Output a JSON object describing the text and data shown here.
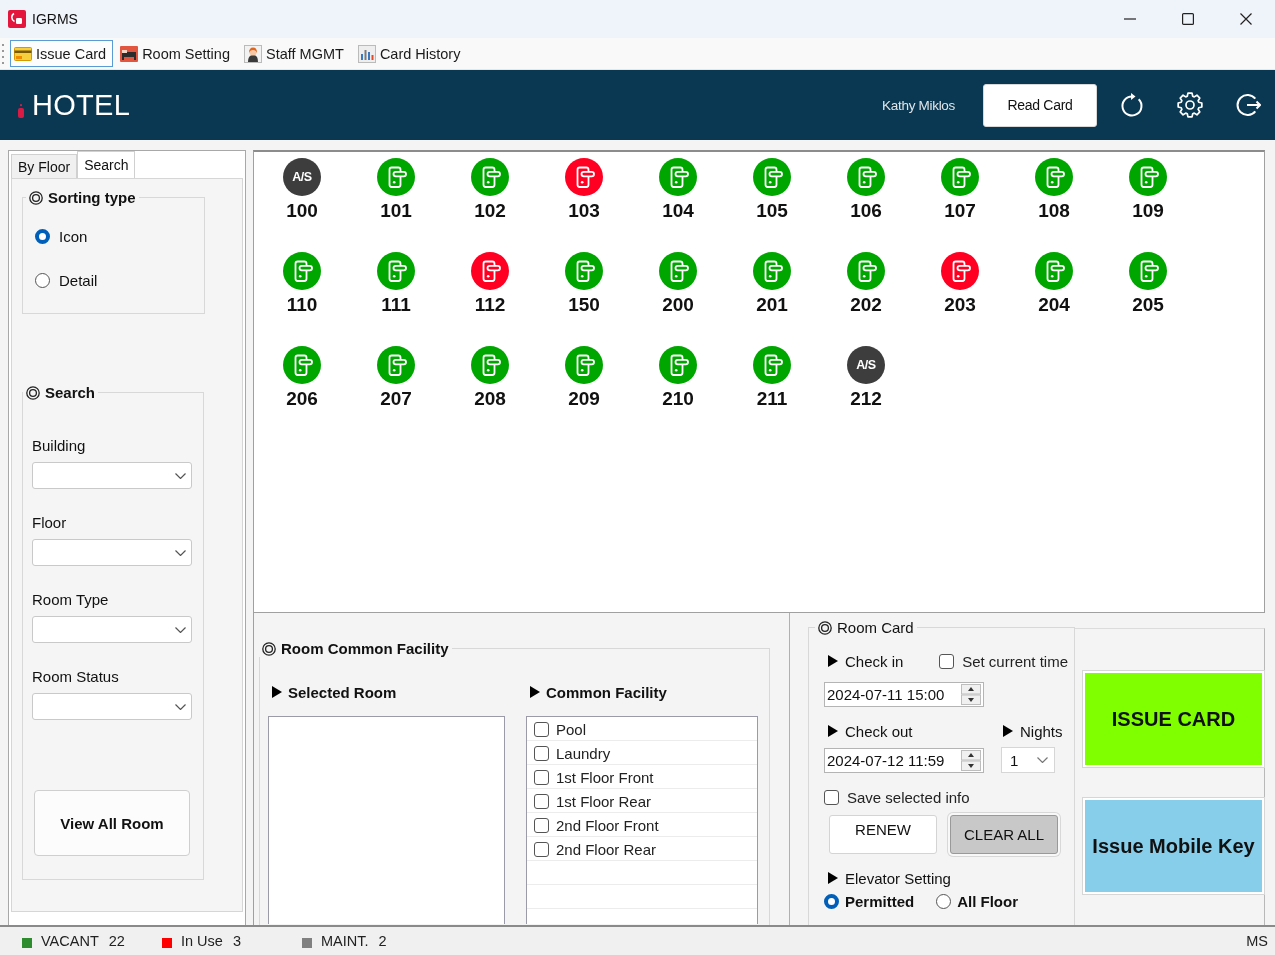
{
  "window": {
    "title": "IGRMS"
  },
  "toolbar": [
    {
      "label": "Issue Card",
      "selected": true
    },
    {
      "label": "Room Setting",
      "selected": false
    },
    {
      "label": "Staff MGMT",
      "selected": false
    },
    {
      "label": "Card History",
      "selected": false
    }
  ],
  "header": {
    "logo": "HOTEL",
    "user": "Kathy Miklos",
    "read_card_button": "Read Card"
  },
  "side_panel": {
    "tabs": [
      {
        "label": "By Floor",
        "selected": false
      },
      {
        "label": "Search",
        "selected": true
      }
    ],
    "sorting": {
      "title": "Sorting type",
      "options": [
        {
          "label": "Icon",
          "selected": true
        },
        {
          "label": "Detail",
          "selected": false
        }
      ]
    },
    "search": {
      "title": "Search",
      "fields": [
        {
          "label": "Building"
        },
        {
          "label": "Floor"
        },
        {
          "label": "Room Type"
        },
        {
          "label": "Room Status"
        }
      ],
      "button": "View All Room"
    }
  },
  "rooms": [
    {
      "number": "100",
      "kind": "maint",
      "badge": "A/S"
    },
    {
      "number": "101",
      "kind": "vacant"
    },
    {
      "number": "102",
      "kind": "vacant"
    },
    {
      "number": "103",
      "kind": "in_use"
    },
    {
      "number": "104",
      "kind": "vacant"
    },
    {
      "number": "105",
      "kind": "vacant"
    },
    {
      "number": "106",
      "kind": "vacant"
    },
    {
      "number": "107",
      "kind": "vacant"
    },
    {
      "number": "108",
      "kind": "vacant"
    },
    {
      "number": "109",
      "kind": "vacant"
    },
    {
      "number": "110",
      "kind": "vacant"
    },
    {
      "number": "111",
      "kind": "vacant"
    },
    {
      "number": "112",
      "kind": "in_use"
    },
    {
      "number": "150",
      "kind": "vacant"
    },
    {
      "number": "200",
      "kind": "vacant"
    },
    {
      "number": "201",
      "kind": "vacant"
    },
    {
      "number": "202",
      "kind": "vacant"
    },
    {
      "number": "203",
      "kind": "in_use"
    },
    {
      "number": "204",
      "kind": "vacant"
    },
    {
      "number": "205",
      "kind": "vacant"
    },
    {
      "number": "206",
      "kind": "vacant"
    },
    {
      "number": "207",
      "kind": "vacant"
    },
    {
      "number": "208",
      "kind": "vacant"
    },
    {
      "number": "209",
      "kind": "vacant"
    },
    {
      "number": "210",
      "kind": "vacant"
    },
    {
      "number": "211",
      "kind": "vacant"
    },
    {
      "number": "212",
      "kind": "maint",
      "badge": "A/S"
    }
  ],
  "facility": {
    "title": "Room Common Facility",
    "selected_room": {
      "label": "Selected Room"
    },
    "common_facility": {
      "label": "Common Facility",
      "items": [
        {
          "label": "Pool",
          "checked": false
        },
        {
          "label": "Laundry",
          "checked": false
        },
        {
          "label": "1st Floor Front",
          "checked": false
        },
        {
          "label": "1st Floor Rear",
          "checked": false
        },
        {
          "label": "2nd Floor Front",
          "checked": false
        },
        {
          "label": "2nd Floor Rear",
          "checked": false
        }
      ]
    }
  },
  "room_card": {
    "title": "Room Card",
    "check_in": {
      "label": "Check in",
      "value": "2024-07-11 15:00"
    },
    "set_current_time": {
      "label": "Set current time",
      "checked": false
    },
    "check_out": {
      "label": "Check out",
      "value": "2024-07-12 11:59"
    },
    "nights": {
      "label": "Nights",
      "value": "1"
    },
    "save_selected_info": {
      "label": "Save selected info",
      "checked": false
    },
    "buttons": [
      {
        "label": "RENEW",
        "kind": "plain"
      },
      {
        "label": "CLEAR ALL",
        "kind": "shaded"
      }
    ],
    "elevator": {
      "label": "Elevator Setting",
      "options": [
        {
          "label": "Permitted",
          "selected": true
        },
        {
          "label": "All Floor",
          "selected": false
        }
      ]
    }
  },
  "actions": [
    {
      "label": "ISSUE CARD",
      "color": "#80ff00"
    },
    {
      "label": "Issue Mobile Key",
      "color": "#87ceeb"
    }
  ],
  "status_bar": {
    "legend": [
      {
        "label": "VACANT",
        "count": "22",
        "color": "#2e8b2e"
      },
      {
        "label": "In Use",
        "count": "3",
        "color": "#ff0000"
      },
      {
        "label": "MAINT.",
        "count": "2",
        "color": "#808080"
      }
    ],
    "right_text": "MS"
  }
}
